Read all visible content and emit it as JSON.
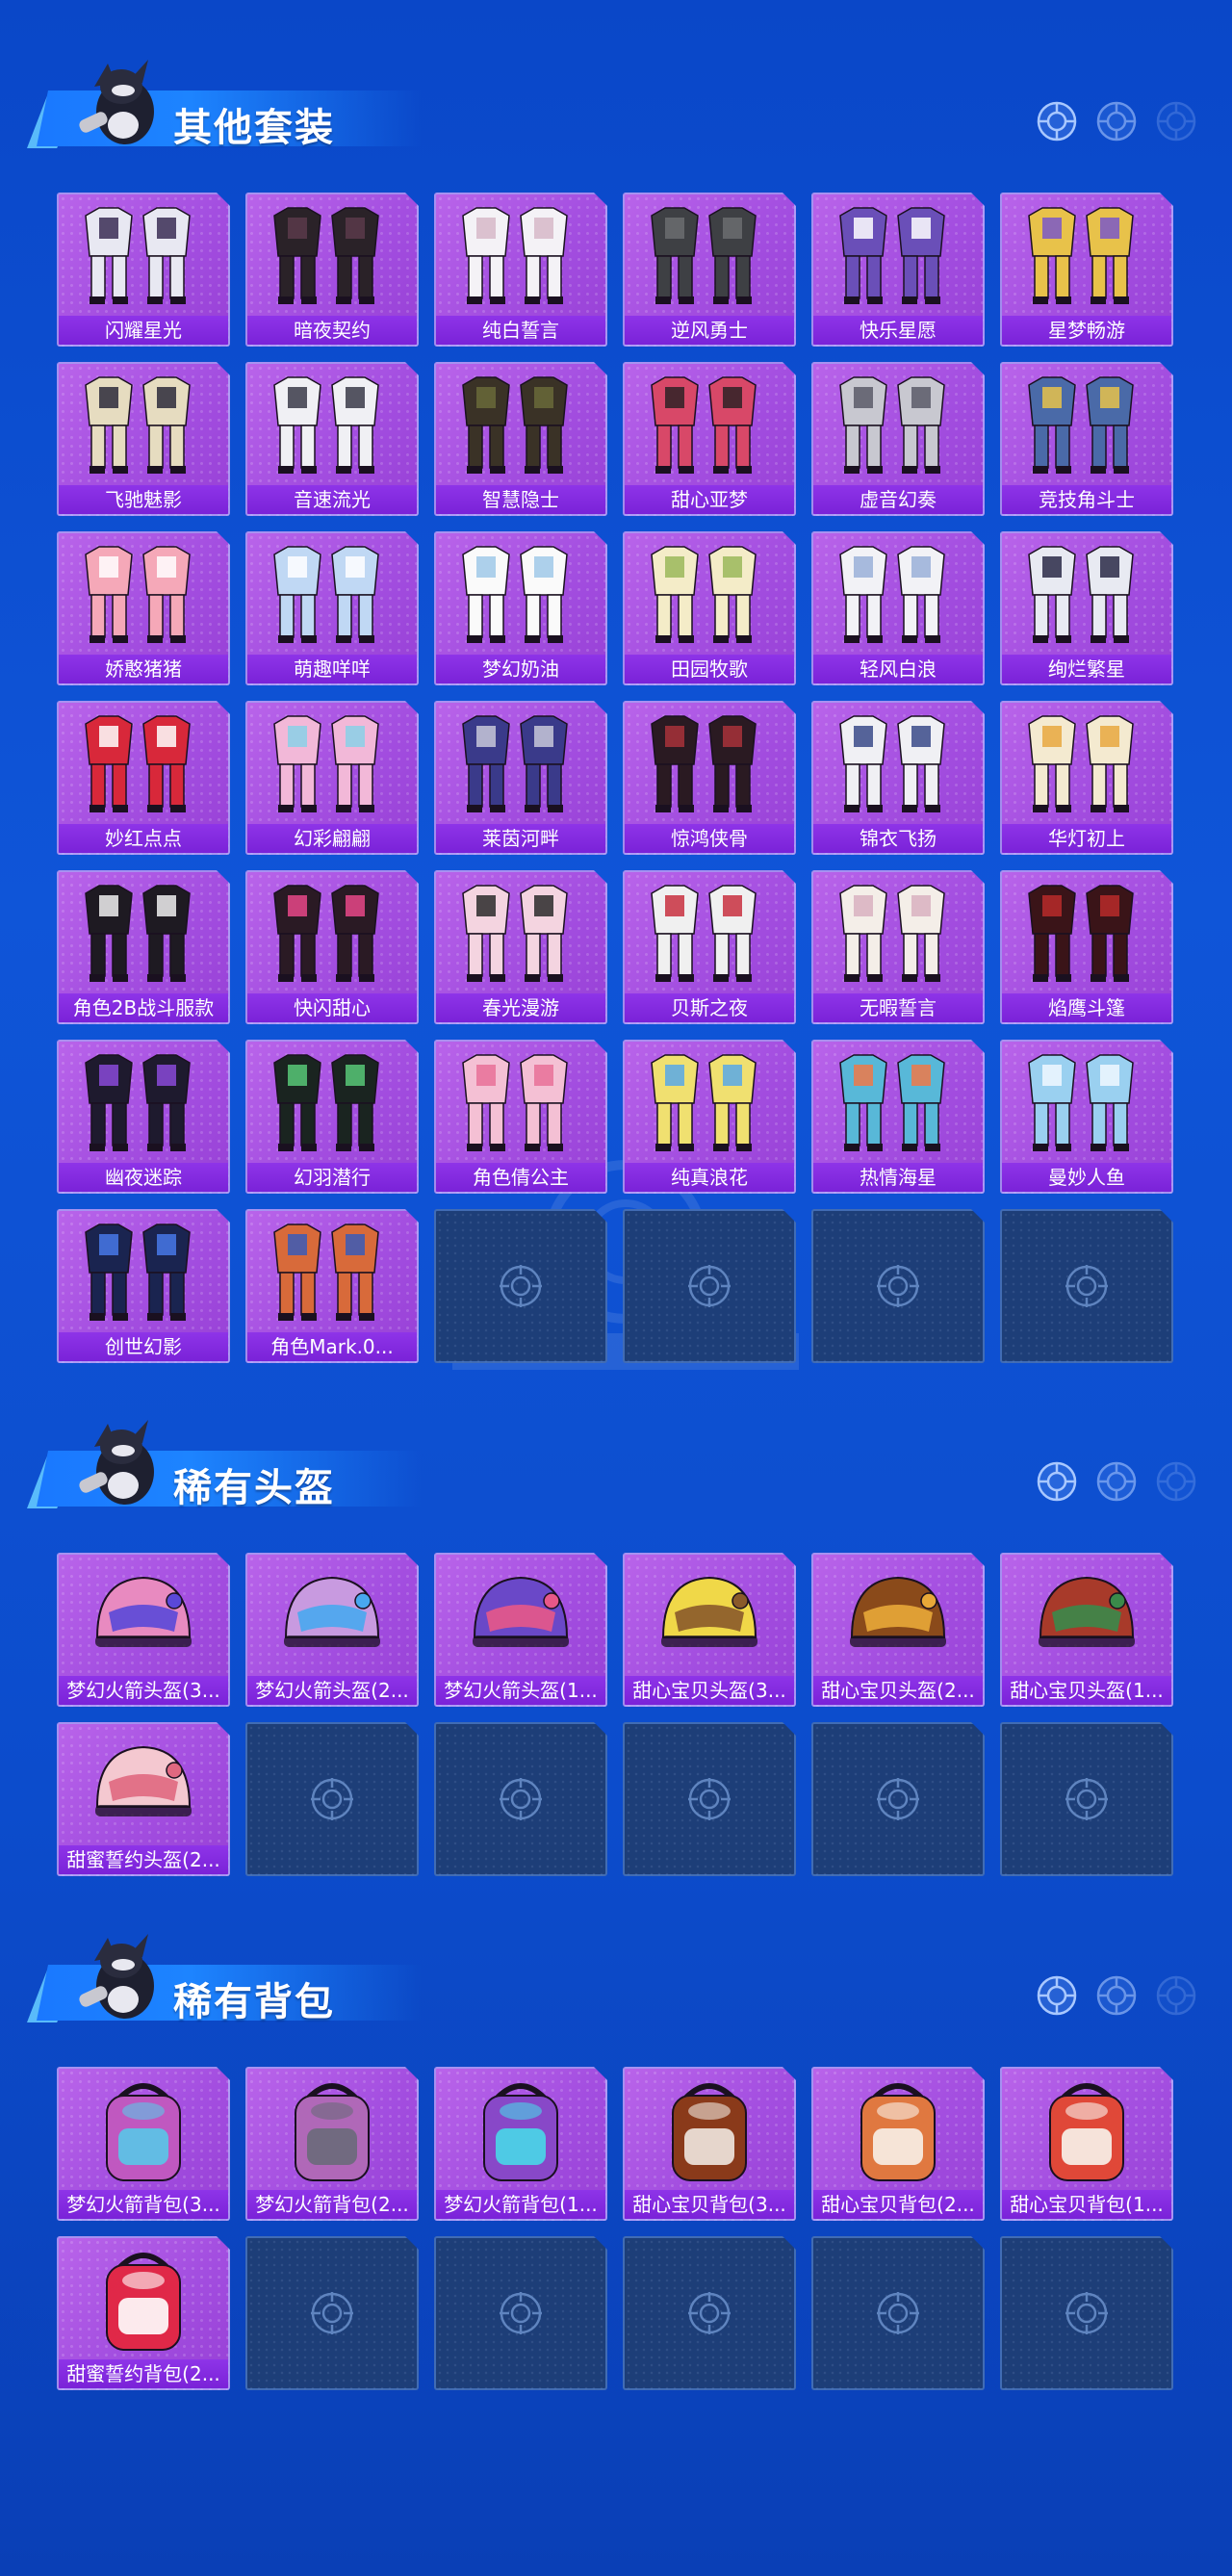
{
  "sections": [
    {
      "title": "其他套装",
      "kind": "outfit",
      "empty_slots": 4,
      "items": [
        {
          "label": "闪耀星光",
          "color": "#e8e8f2",
          "accent": "#3a2d55"
        },
        {
          "label": "暗夜契约",
          "color": "#2a2228",
          "accent": "#5a3a4a"
        },
        {
          "label": "纯白誓言",
          "color": "#f4f2f6",
          "accent": "#d6b8c8"
        },
        {
          "label": "逆风勇士",
          "color": "#3e4044",
          "accent": "#6b6d70"
        },
        {
          "label": "快乐星愿",
          "color": "#6a4fb8",
          "accent": "#ffffff"
        },
        {
          "label": "星梦畅游",
          "color": "#e8c24a",
          "accent": "#7a58c8"
        },
        {
          "label": "飞驰魅影",
          "color": "#e6dcc0",
          "accent": "#2b2a3a"
        },
        {
          "label": "音速流光",
          "color": "#f0f0f4",
          "accent": "#3a3a48"
        },
        {
          "label": "智慧隐士",
          "color": "#3a3226",
          "accent": "#6a6a3a"
        },
        {
          "label": "甜心亚梦",
          "color": "#d84868",
          "accent": "#2e2226"
        },
        {
          "label": "虚音幻奏",
          "color": "#c8c8d0",
          "accent": "#5a5a68"
        },
        {
          "label": "竞技角斗士",
          "color": "#4a6aa8",
          "accent": "#e8c24a"
        },
        {
          "label": "娇憨猪猪",
          "color": "#f5a8b8",
          "accent": "#ffffff"
        },
        {
          "label": "萌趣咩咩",
          "color": "#c0d8f4",
          "accent": "#ffffff"
        },
        {
          "label": "梦幻奶油",
          "color": "#fafafa",
          "accent": "#9fc8e8"
        },
        {
          "label": "田园牧歌",
          "color": "#f4ecc8",
          "accent": "#9ab85a"
        },
        {
          "label": "轻风白浪",
          "color": "#f2f2f6",
          "accent": "#9ab0d8"
        },
        {
          "label": "绚烂繁星",
          "color": "#e8eaf2",
          "accent": "#2a2a48"
        },
        {
          "label": "妙红点点",
          "color": "#d8283a",
          "accent": "#ffffff"
        },
        {
          "label": "幻彩翩翩",
          "color": "#f2b8d8",
          "accent": "#8ad0e8"
        },
        {
          "label": "莱茵河畔",
          "color": "#3a3a8a",
          "accent": "#c8c8d8"
        },
        {
          "label": "惊鸿侠骨",
          "color": "#2a1a22",
          "accent": "#a8323a"
        },
        {
          "label": "锦衣飞扬",
          "color": "#f0f0f4",
          "accent": "#3a4a88"
        },
        {
          "label": "华灯初上",
          "color": "#f4ead0",
          "accent": "#e8a840"
        },
        {
          "label": "角色2B战斗服款",
          "color": "#1e1a22",
          "accent": "#f0f0f0"
        },
        {
          "label": "快闪甜心",
          "color": "#2a1a24",
          "accent": "#e84888"
        },
        {
          "label": "春光漫游",
          "color": "#f4d4e0",
          "accent": "#2a2a2a"
        },
        {
          "label": "贝斯之夜",
          "color": "#f0f0f0",
          "accent": "#c83040"
        },
        {
          "label": "无暇誓言",
          "color": "#f4eee8",
          "accent": "#d8b0c0"
        },
        {
          "label": "焰鹰斗篷",
          "color": "#3a1418",
          "accent": "#b82a2a"
        },
        {
          "label": "幽夜迷踪",
          "color": "#1e1a2e",
          "accent": "#8a4ad8"
        },
        {
          "label": "幻羽潜行",
          "color": "#1a2420",
          "accent": "#58c878"
        },
        {
          "label": "角色倩公主",
          "color": "#f4c0d4",
          "accent": "#e87098"
        },
        {
          "label": "纯真浪花",
          "color": "#f0e070",
          "accent": "#58a8e8"
        },
        {
          "label": "热情海星",
          "color": "#58b8d8",
          "accent": "#f07848"
        },
        {
          "label": "曼妙人鱼",
          "color": "#9ad0f0",
          "accent": "#f0f8ff"
        },
        {
          "label": "创世幻影",
          "color": "#1a2450",
          "accent": "#4878e8"
        },
        {
          "label": "角色Mark.0...",
          "color": "#d86a3a",
          "accent": "#3a5ab8"
        }
      ]
    },
    {
      "title": "稀有头盔",
      "kind": "helmet",
      "empty_slots": 5,
      "items": [
        {
          "label": "梦幻火箭头盔(3...",
          "color": "#e88ac0",
          "accent": "#5a48d8"
        },
        {
          "label": "梦幻火箭头盔(2...",
          "color": "#c89ae0",
          "accent": "#48a8f0"
        },
        {
          "label": "梦幻火箭头盔(1...",
          "color": "#6a48c8",
          "accent": "#e85888"
        },
        {
          "label": "甜心宝贝头盔(3...",
          "color": "#f0d848",
          "accent": "#8a5a2a"
        },
        {
          "label": "甜心宝贝头盔(2...",
          "color": "#8a4a1a",
          "accent": "#e8a838"
        },
        {
          "label": "甜心宝贝头盔(1...",
          "color": "#a83a2a",
          "accent": "#3a8a4a"
        },
        {
          "label": "甜蜜誓约头盔(2...",
          "color": "#f4c8d0",
          "accent": "#e06880"
        }
      ]
    },
    {
      "title": "稀有背包",
      "kind": "backpack",
      "empty_slots": 5,
      "items": [
        {
          "label": "梦幻火箭背包(3...",
          "color": "#c058c0",
          "accent": "#58c8e8"
        },
        {
          "label": "梦幻火箭背包(2...",
          "color": "#b068b8",
          "accent": "#6a6a7a"
        },
        {
          "label": "梦幻火箭背包(1...",
          "color": "#8848c8",
          "accent": "#48d8e8"
        },
        {
          "label": "甜心宝贝背包(3...",
          "color": "#8a3a1a",
          "accent": "#f0e8e0"
        },
        {
          "label": "甜心宝贝背包(2...",
          "color": "#e07840",
          "accent": "#f8f0e8"
        },
        {
          "label": "甜心宝贝背包(1...",
          "color": "#e04838",
          "accent": "#f8f4ec"
        },
        {
          "label": "甜蜜誓约背包(2...",
          "color": "#e02848",
          "accent": "#ffffff"
        }
      ]
    }
  ]
}
